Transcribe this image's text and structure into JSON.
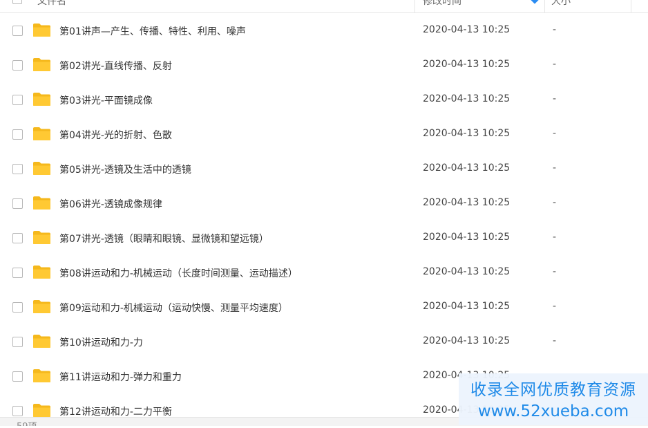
{
  "header": {
    "name_label": "文件名",
    "modified_label": "修改时间",
    "size_label": "大小"
  },
  "icons": {
    "folder": "folder-icon",
    "sort": "sort-desc-icon",
    "folder_color": "#ffc933"
  },
  "files": [
    {
      "name": "第01讲声—产生、传播、特性、利用、噪声",
      "modified": "2020-04-13 10:25",
      "size": "-"
    },
    {
      "name": "第02讲光-直线传播、反射",
      "modified": "2020-04-13 10:25",
      "size": "-"
    },
    {
      "name": "第03讲光-平面镜成像",
      "modified": "2020-04-13 10:25",
      "size": "-"
    },
    {
      "name": "第04讲光-光的折射、色散",
      "modified": "2020-04-13 10:25",
      "size": "-"
    },
    {
      "name": "第05讲光-透镜及生活中的透镜",
      "modified": "2020-04-13 10:25",
      "size": "-"
    },
    {
      "name": "第06讲光-透镜成像规律",
      "modified": "2020-04-13 10:25",
      "size": "-"
    },
    {
      "name": "第07讲光-透镜（眼睛和眼镜、显微镜和望远镜）",
      "modified": "2020-04-13 10:25",
      "size": "-"
    },
    {
      "name": "第08讲运动和力-机械运动（长度时间测量、运动描述）",
      "modified": "2020-04-13 10:25",
      "size": "-"
    },
    {
      "name": "第09运动和力-机械运动（运动快慢、测量平均速度）",
      "modified": "2020-04-13 10:25",
      "size": "-"
    },
    {
      "name": "第10讲运动和力-力",
      "modified": "2020-04-13 10:25",
      "size": "-"
    },
    {
      "name": "第11讲运动和力-弹力和重力",
      "modified": "2020-04-13 10:25",
      "size": ""
    },
    {
      "name": "第12讲运动和力-二力平衡",
      "modified": "2020-04-13 10:25",
      "size": ""
    }
  ],
  "footer": {
    "count": "59项"
  },
  "watermark": {
    "line1": "收录全网优质教育资源",
    "line2": "www.52xueba.com"
  }
}
